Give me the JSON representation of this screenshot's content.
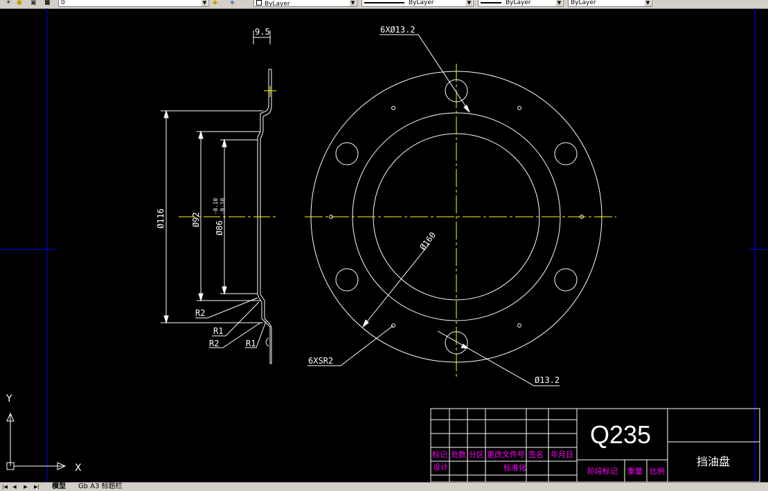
{
  "toolbar": {
    "layer_combo_value": "0",
    "color_combo_value": "ByLayer",
    "linetype_combo_value": "ByLayer",
    "lineweight_combo_value": "ByLayer",
    "plotstyle_combo_value": "ByLayer"
  },
  "drawing": {
    "dim_thickness": "9.5",
    "dim_holes_top": "6XØ13.2",
    "dim_outer_dia": "Ø116",
    "dim_mid_dia": "Ø92",
    "dim_inner_dia": "Ø86",
    "tol_upper": "-0.10",
    "tol_lower": "-0.10",
    "radius_r2_a": "R2",
    "radius_r1_a": "R1",
    "radius_r2_b": "R2",
    "radius_r1_b": "R1",
    "dim_bcd": "Ø160",
    "dim_sr": "6XSR2",
    "dim_hole_bottom": "Ø13.2"
  },
  "ucs": {
    "y_label": "Y",
    "x_label": "X"
  },
  "title_block": {
    "material": "Q235",
    "part_name": "挡油盘",
    "headers": [
      "标记",
      "处数",
      "分区",
      "更改文件号",
      "签名",
      "年月日"
    ],
    "design_label": "设计",
    "standardize_label": "标准化",
    "stage_mark_label": "阶段标记",
    "weight_label": "重量",
    "scale_label": "比例"
  },
  "tabs": {
    "model": "模型",
    "layout1": "Gb A3 标题栏"
  },
  "colors": {
    "background": "#000000",
    "lines": "#ffffff",
    "centerline": "#ffff00",
    "border": "#0000ff",
    "titleblock_text": "#ff00ff"
  }
}
